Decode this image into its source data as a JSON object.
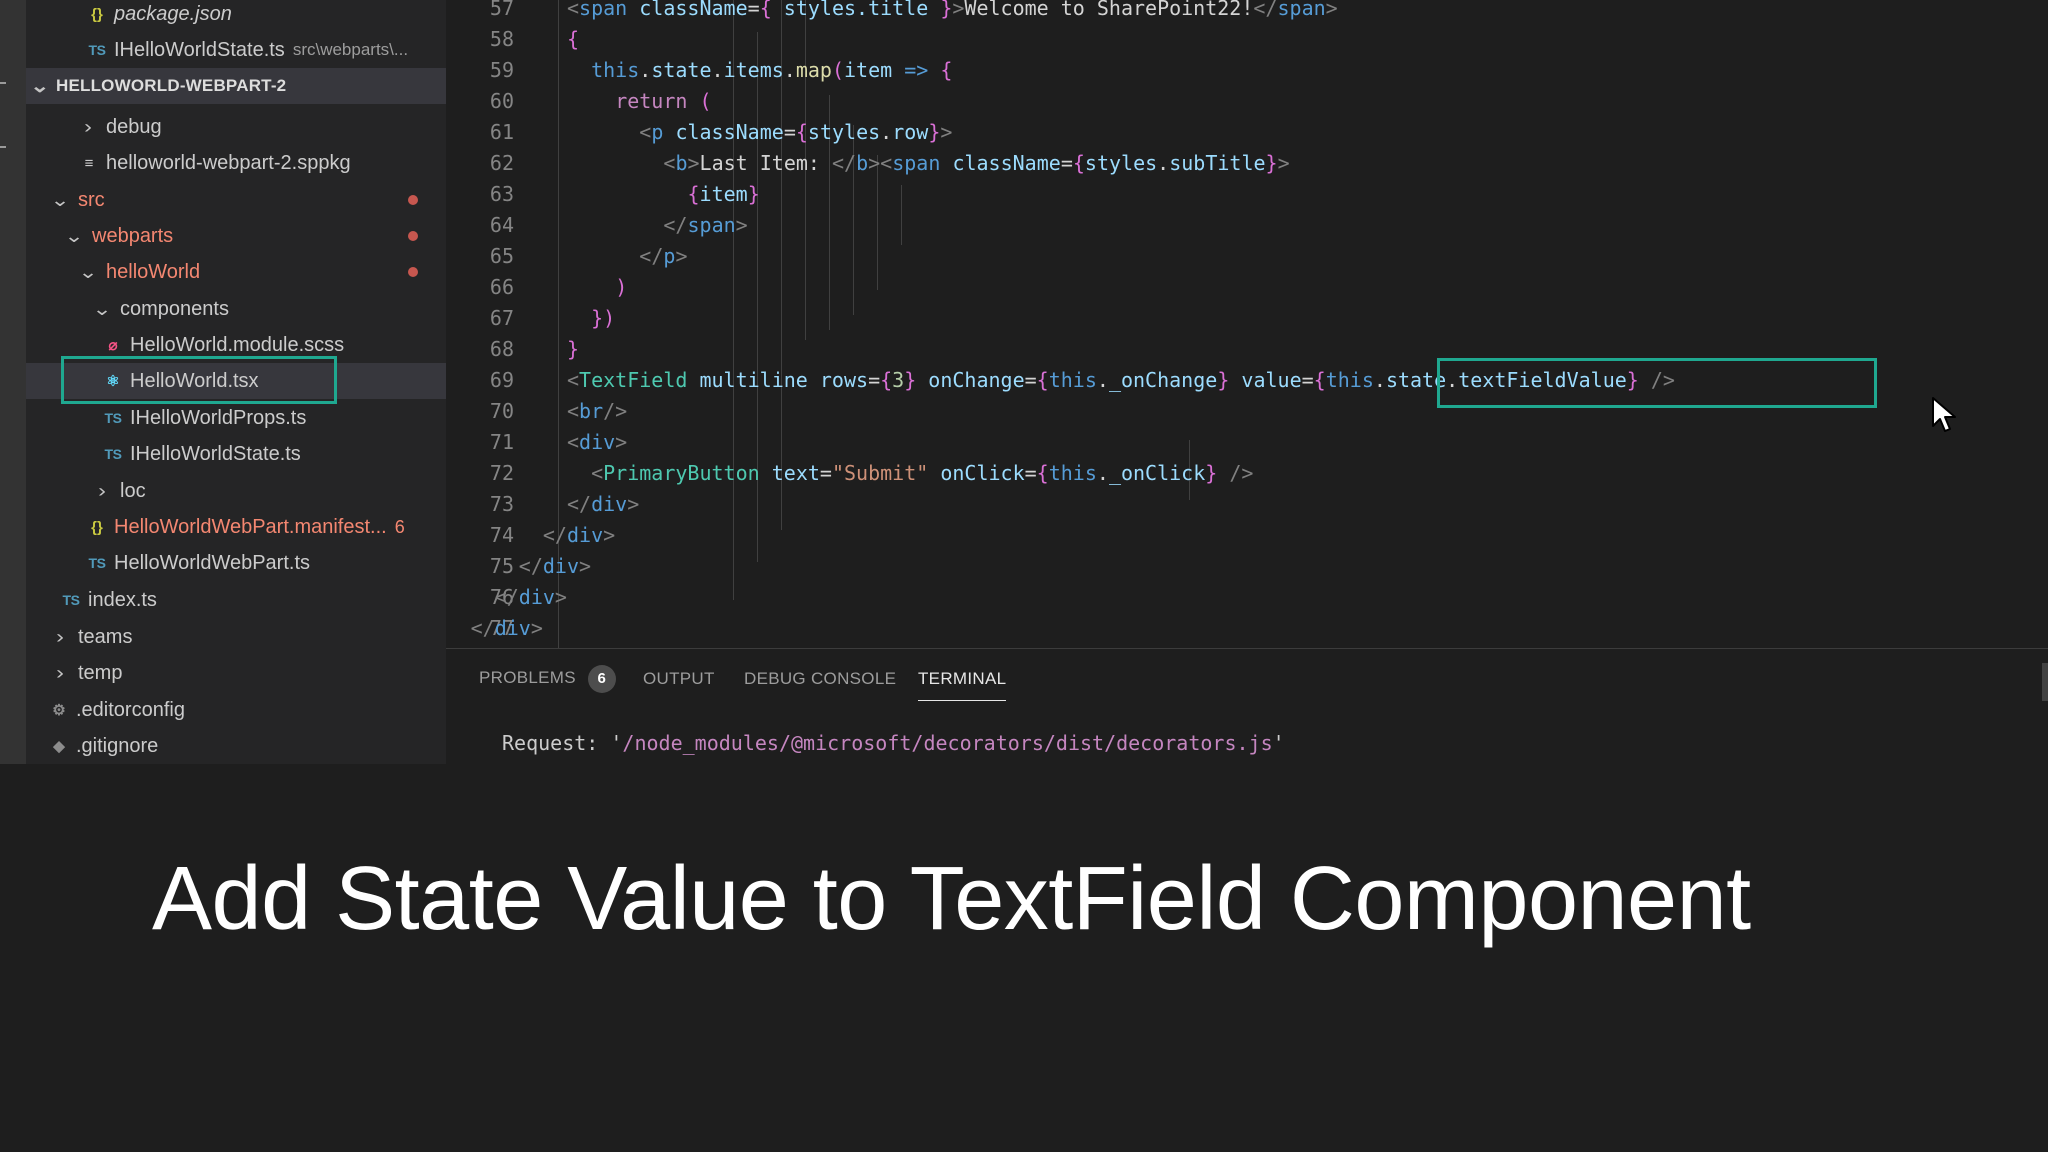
{
  "explorer": {
    "items": [
      {
        "label": "package.json",
        "icon": "json-icon",
        "glyph": "{}"
      },
      {
        "label": "IHelloWorldState.ts",
        "suffix": "src\\webparts\\...",
        "icon": "typescript-icon",
        "glyph": "TS"
      },
      {
        "label": "HELLOWORLD-WEBPART-2"
      },
      {
        "label": "debug"
      },
      {
        "label": "helloworld-webpart-2.sppkg",
        "icon": "package-list-icon",
        "glyph": "≡"
      },
      {
        "label": "src"
      },
      {
        "label": "webparts"
      },
      {
        "label": "helloWorld"
      },
      {
        "label": "components"
      },
      {
        "label": "HelloWorld.module.scss",
        "icon": "scss-icon",
        "glyph": "⌀"
      },
      {
        "label": "HelloWorld.tsx",
        "icon": "react-icon",
        "glyph": "⚛"
      },
      {
        "label": "IHelloWorldProps.ts",
        "icon": "typescript-icon",
        "glyph": "TS"
      },
      {
        "label": "IHelloWorldState.ts",
        "icon": "typescript-icon",
        "glyph": "TS"
      },
      {
        "label": "loc"
      },
      {
        "label": "HelloWorldWebPart.manifest...",
        "badge": "6",
        "icon": "json-icon",
        "glyph": "{}"
      },
      {
        "label": "HelloWorldWebPart.ts",
        "icon": "typescript-icon",
        "glyph": "TS"
      },
      {
        "label": "index.ts",
        "icon": "typescript-icon",
        "glyph": "TS"
      },
      {
        "label": "teams"
      },
      {
        "label": "temp"
      },
      {
        "label": ".editorconfig",
        "icon": "gear-icon",
        "glyph": "⚙"
      },
      {
        "label": ".gitignore",
        "icon": "git-icon",
        "glyph": "◆"
      }
    ]
  },
  "editor": {
    "line_numbers": [
      "57",
      "58",
      "59",
      "60",
      "61",
      "62",
      "63",
      "64",
      "65",
      "66",
      "67",
      "68",
      "69",
      "70",
      "71",
      "72",
      "73",
      "74",
      "75",
      "76",
      "77"
    ],
    "lines": [
      [
        "<",
        "span",
        " ",
        "className",
        "=",
        "{",
        " styles.title ",
        "}",
        ">",
        "Welcome to SharePoint22!",
        "</",
        "span",
        ">"
      ],
      [
        "{"
      ],
      [
        "this",
        ".",
        "state",
        ".",
        "items",
        ".",
        "map",
        "(",
        "item",
        " ",
        "=>",
        " ",
        "{"
      ],
      [
        "return",
        " ",
        "("
      ],
      [
        "<",
        "p",
        " ",
        "className",
        "=",
        "{",
        "styles",
        ".",
        "row",
        "}",
        ">"
      ],
      [
        "<",
        "b",
        ">",
        "Last Item: ",
        "</",
        "b",
        ">",
        "<",
        "span",
        " ",
        "className",
        "=",
        "{",
        "styles",
        ".",
        "subTitle",
        "}",
        ">"
      ],
      [
        "{",
        "item",
        "}"
      ],
      [
        "</",
        "span",
        ">"
      ],
      [
        "</",
        "p",
        ">"
      ],
      [
        ")"
      ],
      [
        "})"
      ],
      [
        "}"
      ],
      [
        "<",
        "TextField",
        " ",
        "multiline",
        " ",
        "rows",
        "=",
        "{",
        "3",
        "}",
        " ",
        "onChange",
        "=",
        "{",
        "this",
        ".",
        "_onChange",
        "}",
        " ",
        "value",
        "=",
        "{",
        "this",
        ".",
        "state",
        ".",
        "textFieldValue",
        "}",
        " ",
        "/>"
      ],
      [
        "<",
        "br",
        "/>"
      ],
      [
        "<",
        "div",
        ">"
      ],
      [
        "<",
        "PrimaryButton",
        " ",
        "text",
        "=",
        "\"Submit\"",
        " ",
        "onClick",
        "=",
        "{",
        "this",
        ".",
        "_onClick",
        "}",
        " ",
        "/>"
      ],
      [
        "</",
        "div",
        ">"
      ],
      [
        "</",
        "div",
        ">"
      ],
      [
        "</",
        "div",
        ">"
      ],
      [
        "</",
        "div",
        ">"
      ],
      [
        "</",
        "div",
        ">"
      ]
    ]
  },
  "panel": {
    "tabs": [
      {
        "label": "PROBLEMS",
        "badge": "6"
      },
      {
        "label": "OUTPUT"
      },
      {
        "label": "DEBUG CONSOLE"
      },
      {
        "label": "TERMINAL"
      }
    ],
    "active_tab": "TERMINAL",
    "terminal": {
      "label": "Request: ",
      "quote_open": "'",
      "path": "/node_modules/@microsoft/decorators/dist/decorators.js",
      "quote_close": "'"
    }
  },
  "caption": {
    "text": "Add State Value to TextField Component"
  },
  "colors": {
    "highlight_box": "#1fa890",
    "folder_modified": "#f48771",
    "editor_bg": "#1e1e1e",
    "sidebar_bg": "#252526"
  }
}
